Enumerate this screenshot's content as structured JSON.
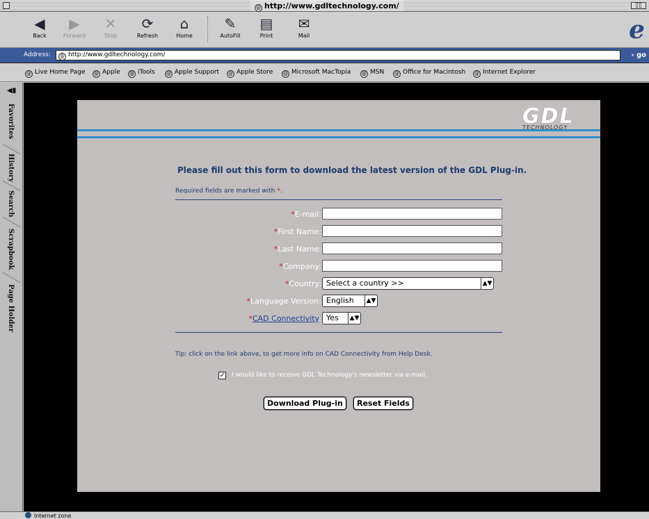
{
  "window": {
    "title": "http://www.gdltechnology.com/"
  },
  "toolbar": {
    "back": "Back",
    "forward": "Forward",
    "stop": "Stop",
    "refresh": "Refresh",
    "home": "Home",
    "autofill": "AutoFill",
    "print": "Print",
    "mail": "Mail"
  },
  "address": {
    "label": "Address:",
    "url": "http://www.gdltechnology.com/",
    "go": "go"
  },
  "favorites": [
    "Live Home Page",
    "Apple",
    "iTools",
    "Apple Support",
    "Apple Store",
    "Microsoft MacTopia",
    "MSN",
    "Office for Macintosh",
    "Internet Explorer"
  ],
  "sidetabs": [
    "Favorites",
    "History",
    "Search",
    "Scrapbook",
    "Page Holder"
  ],
  "logo": {
    "main": "GDL",
    "sub": "TECHNOLOGY"
  },
  "form": {
    "headline": "Please fill out this form to download the latest version of the GDL Plug-in.",
    "required_note": "Required fields are marked with",
    "star": "*",
    "period": ".",
    "fields": {
      "email": "E-mail:",
      "first_name": "First Name:",
      "last_name": "Last Name:",
      "company": "Company:",
      "country": "Country:",
      "language": "Language Version:",
      "cad_link": "CAD Connectivity",
      "cad_colon": ":"
    },
    "country_value": "Select a country >>",
    "language_value": "English",
    "cad_value": "Yes",
    "tip": "Tip: click on the link above, to get more info on CAD Connectivity from Help Desk.",
    "newsletter": "I would like to receive GDL Technology's newsletter via e-mail.",
    "newsletter_checked": true,
    "download_button": "Download Plug-in",
    "reset_button": "Reset Fields"
  },
  "status": {
    "text": "Internet zone"
  }
}
